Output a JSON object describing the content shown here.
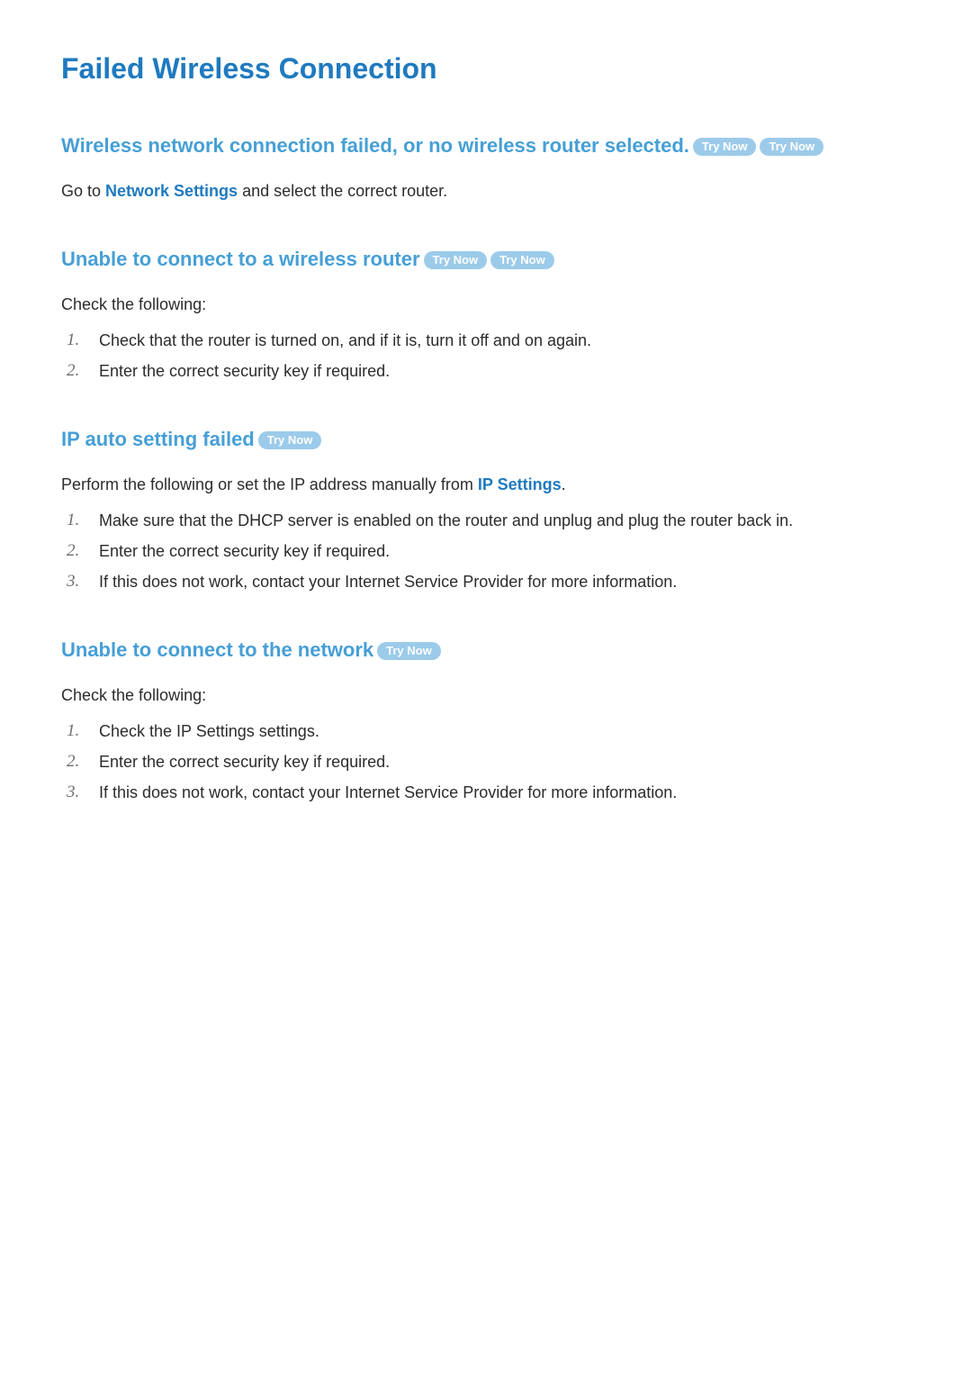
{
  "title": "Failed Wireless Connection",
  "try_now_label": "Try Now",
  "sections": {
    "s1": {
      "heading": "Wireless network connection failed, or no wireless router selected.",
      "body_prefix": "Go to ",
      "body_link": "Network Settings",
      "body_suffix": " and select the correct router."
    },
    "s2": {
      "heading": "Unable to connect to a wireless router",
      "intro": "Check the following:",
      "items": [
        "Check that the router is turned on, and if it is, turn it off and on again.",
        "Enter the correct security key if required."
      ]
    },
    "s3": {
      "heading": "IP auto setting failed",
      "intro_prefix": "Perform the following or set the IP address manually from ",
      "intro_link": "IP Settings",
      "intro_suffix": ".",
      "items": [
        "Make sure that the DHCP server is enabled on the router and unplug and plug the router back in.",
        "Enter the correct security key if required.",
        "If this does not work, contact your Internet Service Provider for more information."
      ]
    },
    "s4": {
      "heading": "Unable to connect to the network",
      "intro": "Check the following:",
      "item1_prefix": "Check the ",
      "item1_link": "IP Settings",
      "item1_suffix": " settings.",
      "items_rest": [
        "Enter the correct security key if required.",
        "If this does not work, contact your Internet Service Provider for more information."
      ]
    }
  }
}
